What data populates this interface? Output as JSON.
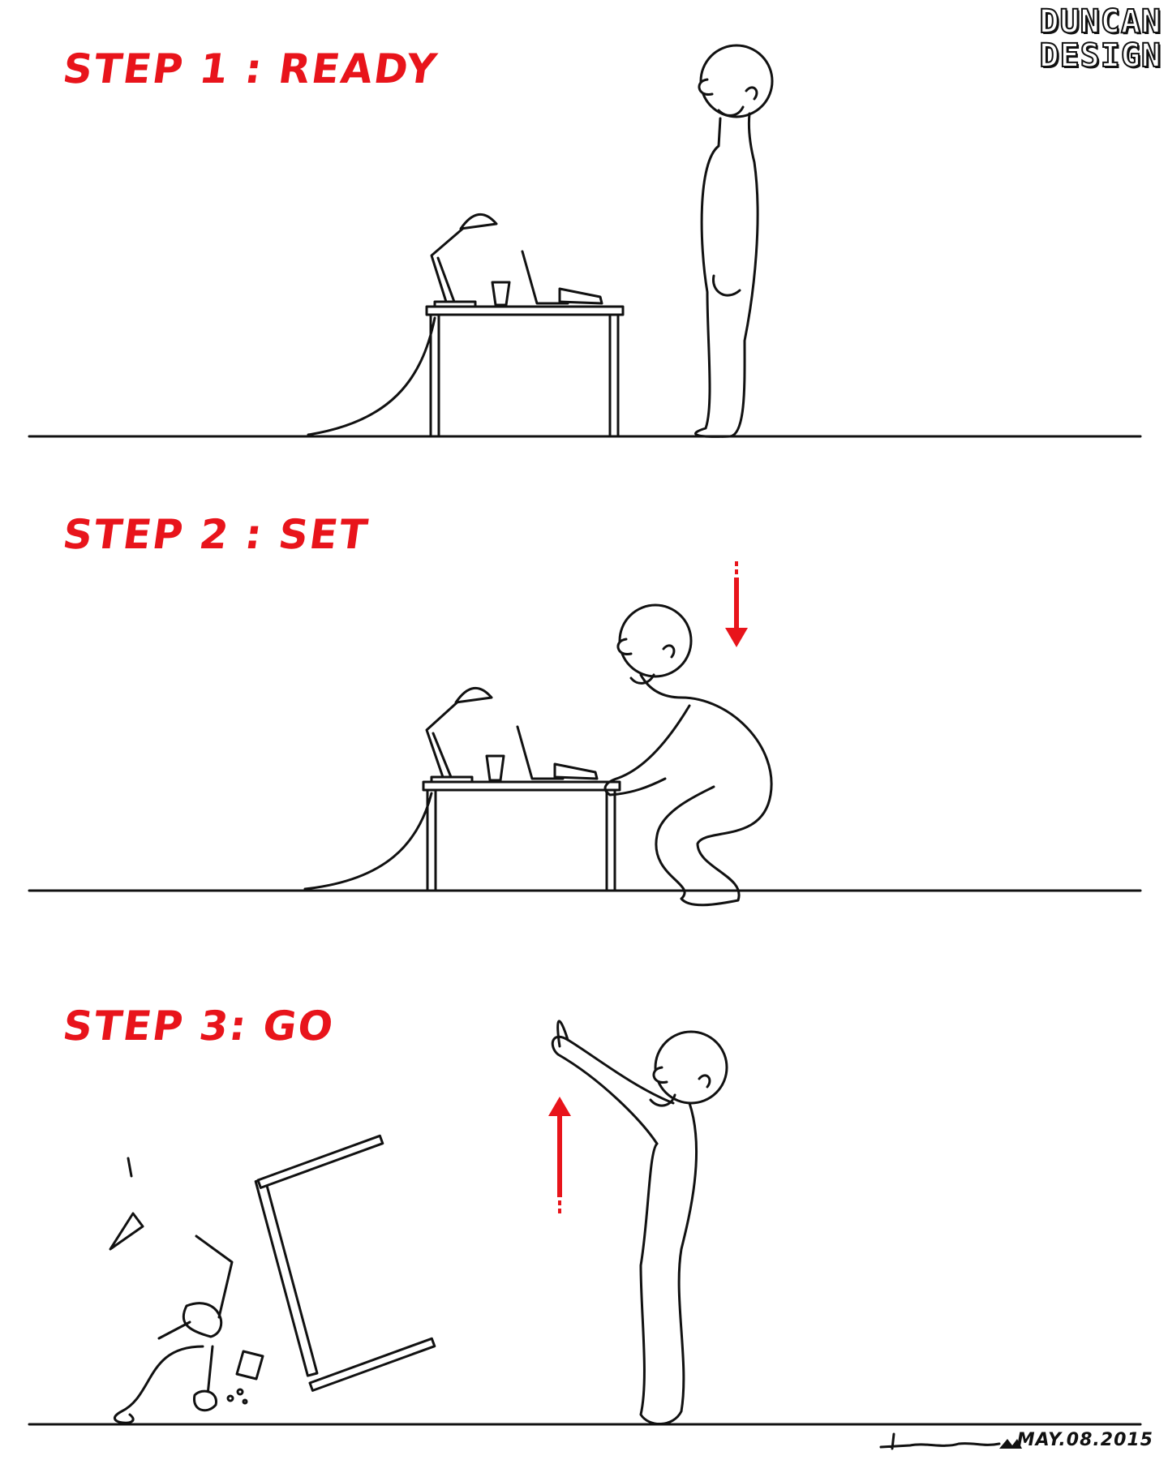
{
  "brand": {
    "line1": "DUNCAN",
    "line2": "DESIGN"
  },
  "panels": [
    {
      "title": "STEP 1 : READY"
    },
    {
      "title": "STEP 2 : SET"
    },
    {
      "title": "STEP 3: GO"
    }
  ],
  "signature": {
    "date": "MAY.08.2015"
  },
  "colors": {
    "title_red": "#e8141b",
    "ink": "#111111",
    "background": "#ffffff"
  }
}
